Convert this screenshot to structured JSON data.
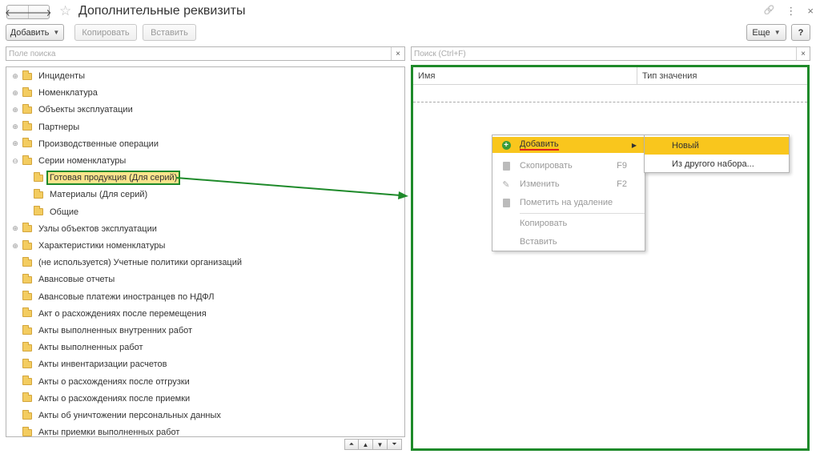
{
  "window": {
    "title": "Дополнительные реквизиты",
    "back_glyph": "🡐",
    "forward_glyph": "🡒",
    "star_glyph": "☆",
    "link_glyph": "🔗",
    "more_glyph": "⋮",
    "close_glyph": "×"
  },
  "toolbar": {
    "add_label": "Добавить",
    "copy_label": "Копировать",
    "paste_label": "Вставить",
    "more_label": "Еще",
    "help_label": "?"
  },
  "left_search": {
    "placeholder": "Поле поиска",
    "clear_glyph": "×"
  },
  "right_search": {
    "placeholder": "Поиск (Ctrl+F)",
    "clear_glyph": "×"
  },
  "tree": {
    "items": [
      {
        "label": "Инциденты",
        "level": 0,
        "expandable": true
      },
      {
        "label": "Номенклатура",
        "level": 0,
        "expandable": true
      },
      {
        "label": "Объекты эксплуатации",
        "level": 0,
        "expandable": true
      },
      {
        "label": "Партнеры",
        "level": 0,
        "expandable": true
      },
      {
        "label": "Производственные операции",
        "level": 0,
        "expandable": true
      },
      {
        "label": "Серии номенклатуры",
        "level": 0,
        "expandable": true,
        "expanded": true
      },
      {
        "label": "Готовая продукция (Для серий)",
        "level": 1,
        "expandable": false,
        "selected": true
      },
      {
        "label": "Материалы (Для серий)",
        "level": 1,
        "expandable": false
      },
      {
        "label": "Общие",
        "level": 1,
        "expandable": false
      },
      {
        "label": "Узлы объектов эксплуатации",
        "level": 0,
        "expandable": true
      },
      {
        "label": "Характеристики номенклатуры",
        "level": 0,
        "expandable": true
      },
      {
        "label": "(не используется) Учетные политики организаций",
        "level": 0,
        "expandable": false
      },
      {
        "label": "Авансовые отчеты",
        "level": 0,
        "expandable": false
      },
      {
        "label": "Авансовые платежи иностранцев по НДФЛ",
        "level": 0,
        "expandable": false
      },
      {
        "label": "Акт о расхождениях после перемещения",
        "level": 0,
        "expandable": false
      },
      {
        "label": "Акты выполненных внутренних работ",
        "level": 0,
        "expandable": false
      },
      {
        "label": "Акты выполненных работ",
        "level": 0,
        "expandable": false
      },
      {
        "label": "Акты инвентаризации расчетов",
        "level": 0,
        "expandable": false
      },
      {
        "label": "Акты о расхождениях после отгрузки",
        "level": 0,
        "expandable": false
      },
      {
        "label": "Акты о расхождениях после приемки",
        "level": 0,
        "expandable": false
      },
      {
        "label": "Акты об уничтожении персональных данных",
        "level": 0,
        "expandable": false
      },
      {
        "label": "Акты приемки выполненных работ",
        "level": 0,
        "expandable": false
      }
    ],
    "expander_glyph": "⊕",
    "collapse_glyph": "⊖",
    "scroll_buttons": [
      "⏶",
      "▲",
      "▼",
      "⏷"
    ]
  },
  "grid": {
    "col_name": "Имя",
    "col_type": "Тип значения"
  },
  "context_menu": {
    "add": "Добавить",
    "copy_item": "Скопировать",
    "copy_shortcut": "F9",
    "edit": "Изменить",
    "edit_shortcut": "F2",
    "mark_delete": "Пометить на удаление",
    "copy": "Копировать",
    "paste": "Вставить",
    "arrow_glyph": "▶"
  },
  "submenu": {
    "new": "Новый",
    "from_set": "Из другого набора..."
  },
  "colors": {
    "highlight": "#f9c61d",
    "annotation_green": "#1e8a2a",
    "annotation_red": "#e02020"
  }
}
